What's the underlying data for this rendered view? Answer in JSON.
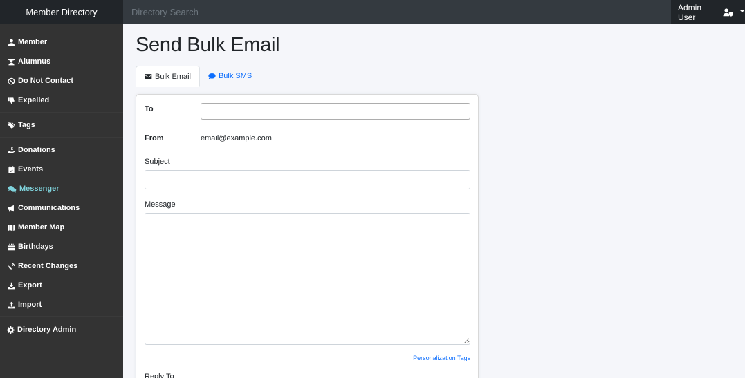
{
  "app": {
    "brand": "Member Directory",
    "search_placeholder": "Directory Search",
    "user_name": "Admin User",
    "user_icon": "user-shield-icon"
  },
  "sidebar": {
    "groups": [
      [
        {
          "label": "Member",
          "icon": "user-icon"
        },
        {
          "label": "Alumnus",
          "icon": "user-graduate-icon"
        },
        {
          "label": "Do Not Contact",
          "icon": "ban-icon"
        },
        {
          "label": "Expelled",
          "icon": "thumbs-down-icon"
        }
      ],
      [
        {
          "label": "Tags",
          "icon": "tags-icon"
        }
      ],
      [
        {
          "label": "Donations",
          "icon": "hand-holding-dollar-icon"
        },
        {
          "label": "Events",
          "icon": "calendar-check-icon"
        },
        {
          "label": "Messenger",
          "icon": "comments-icon",
          "active": true
        },
        {
          "label": "Communications",
          "icon": "bullhorn-icon"
        },
        {
          "label": "Member Map",
          "icon": "map-icon"
        },
        {
          "label": "Birthdays",
          "icon": "birthday-cake-icon"
        },
        {
          "label": "Recent Changes",
          "icon": "satellite-dish-icon"
        },
        {
          "label": "Export",
          "icon": "download-icon"
        },
        {
          "label": "Import",
          "icon": "upload-icon"
        }
      ],
      [
        {
          "label": "Directory Admin",
          "icon": "gear-icon"
        }
      ]
    ]
  },
  "main": {
    "title": "Send Bulk Email",
    "tabs": [
      {
        "label": "Bulk Email",
        "icon": "envelope-icon",
        "active": true
      },
      {
        "label": "Bulk SMS",
        "icon": "sms-icon",
        "active": false
      }
    ],
    "form": {
      "to_label": "To",
      "to_value": "",
      "from_label": "From",
      "from_value": "email@example.com",
      "subject_label": "Subject",
      "subject_value": "",
      "message_label": "Message",
      "message_value": "",
      "personalization_link": "Personalization Tags",
      "reply_to_label": "Reply To"
    }
  },
  "colors": {
    "active_nav": "#7fd3dc",
    "link": "#0d6efd",
    "sidebar_bg": "#333333",
    "topbar_bg": "#343a40"
  }
}
